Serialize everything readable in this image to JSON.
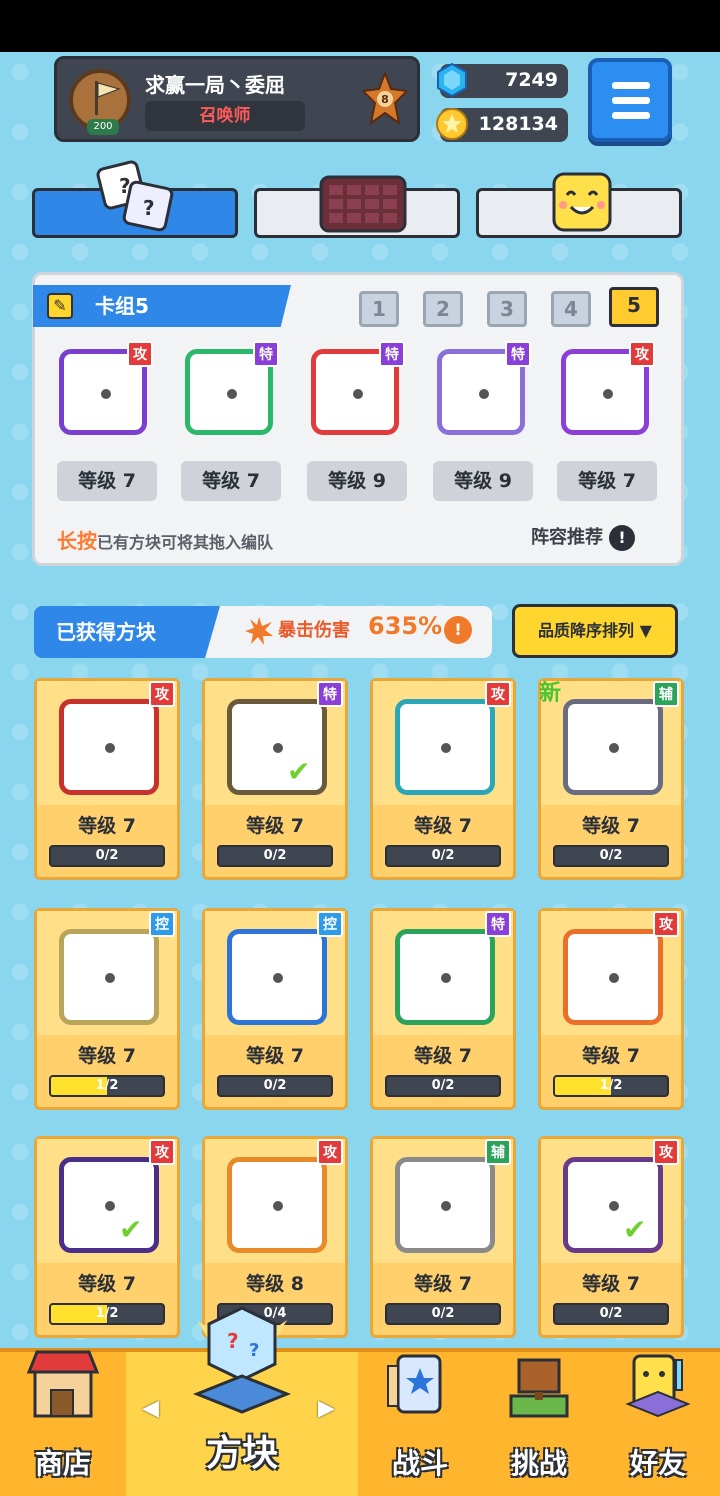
{
  "header": {
    "player_name": "求赢一局丶委屈",
    "player_title": "召唤师",
    "player_level": "200",
    "rank_badge": "8",
    "gems": "7249",
    "coins": "128134"
  },
  "tabs": [
    {
      "name": "dice-tab",
      "icon": "dice-icon"
    },
    {
      "name": "board-tab",
      "icon": "grid-board-icon"
    },
    {
      "name": "emote-tab",
      "icon": "smile-block-icon"
    }
  ],
  "deck": {
    "title": "卡组5",
    "deck_numbers": [
      "1",
      "2",
      "3",
      "4",
      "5"
    ],
    "active_deck": "5",
    "cards": [
      {
        "tag": "攻",
        "level": "等级 7",
        "color": "#7a3fd0"
      },
      {
        "tag": "特",
        "level": "等级 7",
        "color": "#2bb86a"
      },
      {
        "tag": "特",
        "level": "等级 9",
        "color": "#e23b3b"
      },
      {
        "tag": "特",
        "level": "等级 9",
        "color": "#8a6fd8"
      },
      {
        "tag": "攻",
        "level": "等级 7",
        "color": "#8a3fd8"
      }
    ],
    "hint_highlight": "长按",
    "hint_rest": "已有方块可将其拖入编队",
    "recommend": "阵容推荐"
  },
  "obtained": {
    "title": "已获得方块",
    "crit_label": "暴击伤害",
    "crit_value": "635%",
    "sort_label": "品质降序排列"
  },
  "cards": [
    {
      "tag": "攻",
      "level": "等级 7",
      "progress": "0/2",
      "fill": 0,
      "color": "#c8322e",
      "check": false,
      "new": false
    },
    {
      "tag": "特",
      "level": "等级 7",
      "progress": "0/2",
      "fill": 0,
      "color": "#6b5a3a",
      "check": true,
      "new": false
    },
    {
      "tag": "攻",
      "level": "等级 7",
      "progress": "0/2",
      "fill": 0,
      "color": "#2aa6b8",
      "check": false,
      "new": false
    },
    {
      "tag": "辅",
      "level": "等级 7",
      "progress": "0/2",
      "fill": 0,
      "color": "#6a6a80",
      "check": false,
      "new": true
    },
    {
      "tag": "控",
      "level": "等级 7",
      "progress": "1/2",
      "fill": 0.5,
      "color": "#b8a45a",
      "check": false,
      "new": false
    },
    {
      "tag": "控",
      "level": "等级 7",
      "progress": "0/2",
      "fill": 0,
      "color": "#2d74d8",
      "check": false,
      "new": false
    },
    {
      "tag": "特",
      "level": "等级 7",
      "progress": "0/2",
      "fill": 0,
      "color": "#2ba35a",
      "check": false,
      "new": false
    },
    {
      "tag": "攻",
      "level": "等级 7",
      "progress": "1/2",
      "fill": 0.5,
      "color": "#e8702a",
      "check": false,
      "new": false
    },
    {
      "tag": "攻",
      "level": "等级 7",
      "progress": "1/2",
      "fill": 0.5,
      "color": "#4a2f8a",
      "check": true,
      "new": false
    },
    {
      "tag": "攻",
      "level": "等级 8",
      "progress": "0/4",
      "fill": 0,
      "color": "#e88a2a",
      "check": false,
      "new": false
    },
    {
      "tag": "辅",
      "level": "等级 7",
      "progress": "0/2",
      "fill": 0,
      "color": "#8a8a8a",
      "check": false,
      "new": false
    },
    {
      "tag": "攻",
      "level": "等级 7",
      "progress": "0/2",
      "fill": 0,
      "color": "#6a3a8a",
      "check": true,
      "new": false
    }
  ],
  "nav": {
    "shop": "商店",
    "blocks": "方块",
    "battle": "战斗",
    "challenge": "挑战",
    "friends": "好友"
  }
}
